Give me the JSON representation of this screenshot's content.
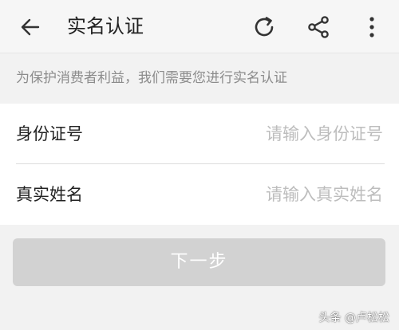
{
  "header": {
    "title": "实名认证",
    "icons": {
      "back": "arrow-left-icon",
      "refresh": "refresh-icon",
      "share": "share-icon",
      "more": "more-vertical-icon"
    }
  },
  "notice": "为保护消费者利益，我们需要您进行实名认证",
  "form": {
    "id_label": "身份证号",
    "id_placeholder": "请输入身份证号",
    "name_label": "真实姓名",
    "name_placeholder": "请输入真实姓名"
  },
  "next_button": "下一步",
  "watermark": "头条 @卢松松",
  "colors": {
    "background": "#f2f2f2",
    "button_disabled": "#d2d2d2",
    "placeholder": "#bdbdbd",
    "notice_text": "#8c8c8c"
  }
}
